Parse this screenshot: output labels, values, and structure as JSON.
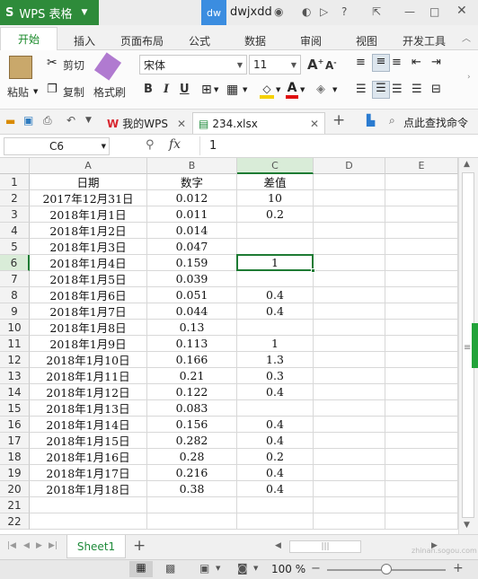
{
  "app": {
    "title": "WPS 表格",
    "avatar_text": "dw",
    "username": "dwjxdd"
  },
  "ribbon_tabs": [
    "开始",
    "插入",
    "页面布局",
    "公式",
    "数据",
    "审阅",
    "视图",
    "开发工具"
  ],
  "ribbon": {
    "cut": "剪切",
    "paste": "粘贴",
    "copy": "复制",
    "format_painter": "格式刷",
    "font_name": "宋体",
    "font_size": "11",
    "bold": "B",
    "italic": "I",
    "underline": "U"
  },
  "doc_tabs": {
    "home": "我的WPS",
    "file": "234.xlsx",
    "search": "点此查找命令"
  },
  "formula_bar": {
    "cell_ref": "C6",
    "fx": "fx",
    "value": "1"
  },
  "columns": [
    "A",
    "B",
    "C",
    "D",
    "E"
  ],
  "rows": [
    {
      "n": "1",
      "a": "日期",
      "b": "数字",
      "c": "差值"
    },
    {
      "n": "2",
      "a": "2017年12月31日",
      "b": "0.012",
      "c": "10"
    },
    {
      "n": "3",
      "a": "2018年1月1日",
      "b": "0.011",
      "c": "0.2"
    },
    {
      "n": "4",
      "a": "2018年1月2日",
      "b": "0.014",
      "c": ""
    },
    {
      "n": "5",
      "a": "2018年1月3日",
      "b": "0.047",
      "c": ""
    },
    {
      "n": "6",
      "a": "2018年1月4日",
      "b": "0.159",
      "c": "1"
    },
    {
      "n": "7",
      "a": "2018年1月5日",
      "b": "0.039",
      "c": ""
    },
    {
      "n": "8",
      "a": "2018年1月6日",
      "b": "0.051",
      "c": "0.4"
    },
    {
      "n": "9",
      "a": "2018年1月7日",
      "b": "0.044",
      "c": "0.4"
    },
    {
      "n": "10",
      "a": "2018年1月8日",
      "b": "0.13",
      "c": ""
    },
    {
      "n": "11",
      "a": "2018年1月9日",
      "b": "0.113",
      "c": "1"
    },
    {
      "n": "12",
      "a": "2018年1月10日",
      "b": "0.166",
      "c": "1.3"
    },
    {
      "n": "13",
      "a": "2018年1月11日",
      "b": "0.21",
      "c": "0.3"
    },
    {
      "n": "14",
      "a": "2018年1月12日",
      "b": "0.122",
      "c": "0.4"
    },
    {
      "n": "15",
      "a": "2018年1月13日",
      "b": "0.083",
      "c": ""
    },
    {
      "n": "16",
      "a": "2018年1月14日",
      "b": "0.156",
      "c": "0.4"
    },
    {
      "n": "17",
      "a": "2018年1月15日",
      "b": "0.282",
      "c": "0.4"
    },
    {
      "n": "18",
      "a": "2018年1月16日",
      "b": "0.28",
      "c": "0.2"
    },
    {
      "n": "19",
      "a": "2018年1月17日",
      "b": "0.216",
      "c": "0.4"
    },
    {
      "n": "20",
      "a": "2018年1月18日",
      "b": "0.38",
      "c": "0.4"
    },
    {
      "n": "21",
      "a": "",
      "b": "",
      "c": ""
    },
    {
      "n": "22",
      "a": "",
      "b": "",
      "c": ""
    }
  ],
  "selected_row": "6",
  "sheet_tab": "Sheet1",
  "status": {
    "zoom": "100 %",
    "watermark": "zhinan.sogou.com"
  },
  "colors": {
    "brand": "#2e8b3a",
    "selection": "#1e7b34",
    "accent_blue": "#3b8de0"
  }
}
